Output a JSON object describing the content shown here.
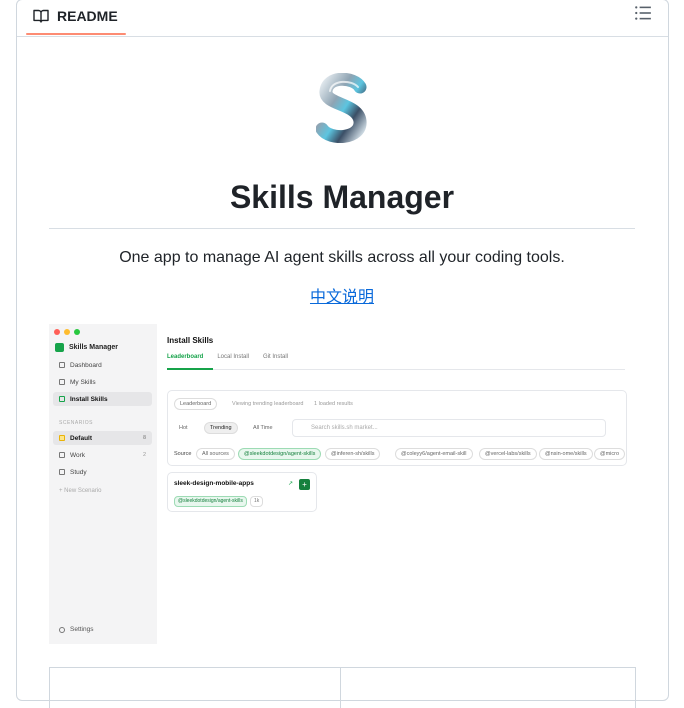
{
  "readme": {
    "tab_label": "README",
    "icons": {
      "tab": "book-icon",
      "outline": "list-icon"
    },
    "accent_color": "#fd8c73"
  },
  "content": {
    "logo_icon": "s-logo-icon",
    "title": "Skills Manager",
    "description": "One app to manage AI agent skills across all your coding tools.",
    "lang_link": "中文说明",
    "link_color": "#0969da"
  },
  "screenshot": {
    "window_dots": [
      "#ff5f57",
      "#febc2e",
      "#28c840"
    ],
    "sidebar": {
      "app_name": "Skills Manager",
      "items": [
        {
          "label": "Dashboard",
          "icon": "grid-icon"
        },
        {
          "label": "My Skills",
          "icon": "layers-icon"
        },
        {
          "label": "Install Skills",
          "icon": "download-icon",
          "active": true
        }
      ],
      "section_label": "SCENARIOS",
      "scenarios": [
        {
          "label": "Default",
          "count": "8",
          "active": true
        },
        {
          "label": "Work",
          "count": "2"
        },
        {
          "label": "Study",
          "count": ""
        }
      ],
      "new_scenario": "+ New Scenario",
      "settings": "Settings"
    },
    "main": {
      "title": "Install Skills",
      "tabs": [
        "Leaderboard",
        "Local Install",
        "Git Install"
      ],
      "leaderboard_pill": "Leaderboard",
      "note_viewing": "Viewing trending leaderboard",
      "note_loaded": "1 loaded results",
      "filters": [
        "Hot",
        "Trending",
        "All Time"
      ],
      "search_placeholder": "Search skills.sh market...",
      "source_label": "Source",
      "sources": [
        "All sources",
        "@sleekdotdesign/agent-skills",
        "@inferen-sh/skills",
        "@coleyy6/agent-email-skill",
        "@vercel-labs/skills",
        "@nsin-ome/skills",
        "@micro"
      ],
      "card": {
        "title": "sleek-design-mobile-apps",
        "tag": "@sleekdotdesign/agent-skills",
        "stat": "1k",
        "add_label": "+"
      }
    }
  }
}
